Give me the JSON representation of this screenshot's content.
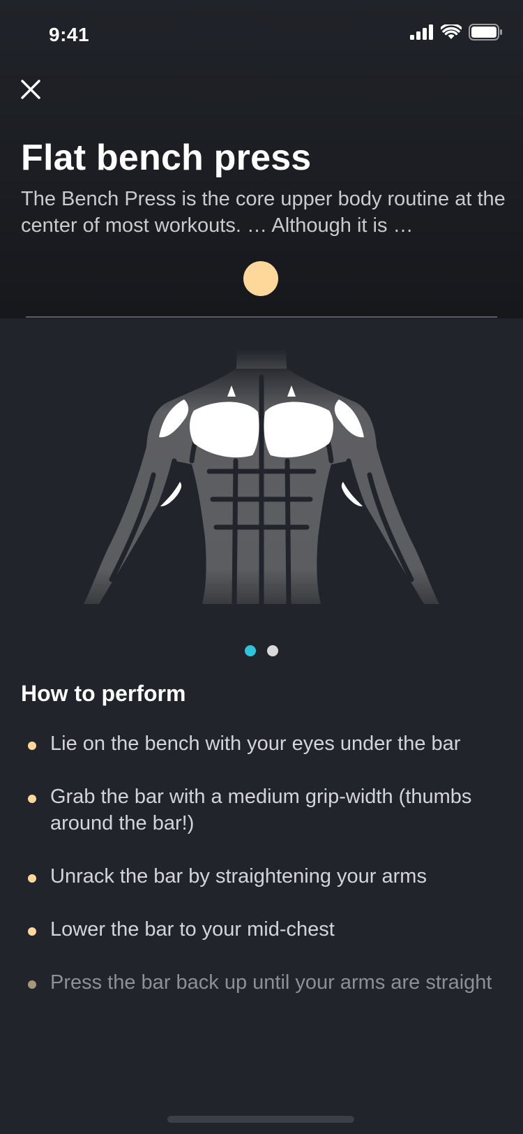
{
  "status_bar": {
    "time": "9:41"
  },
  "header": {
    "title": "Flat bench press",
    "description": "The Bench Press is the core upper body routine at the center of most workouts. … Although it is …",
    "accent_color": "#fed89b"
  },
  "illustration": {
    "icon": "muscle-diagram-chest"
  },
  "pager": {
    "active_color": "#2ec4dc",
    "inactive_color": "#d9d9d9"
  },
  "how_to": {
    "title": "How to perform",
    "steps": [
      "Lie on the bench with your eyes under the bar",
      "Grab the bar with a medium grip-width (thumbs around the bar!)",
      "Unrack the bar by straightening your arms",
      "Lower the bar to your mid-chest",
      "Press the bar back up until your arms are straight"
    ]
  }
}
